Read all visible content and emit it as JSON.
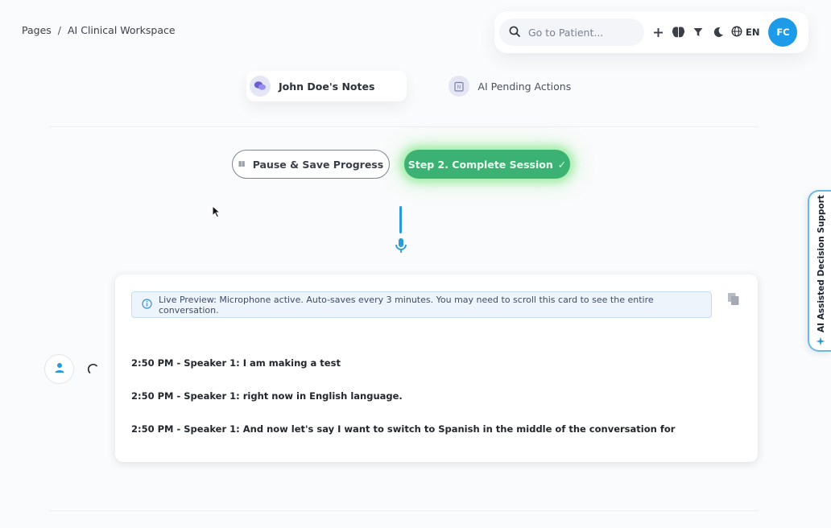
{
  "breadcrumb": {
    "root": "Pages",
    "separator": "/",
    "current": "AI Clinical Workspace"
  },
  "header": {
    "search_placeholder": "Go to Patient...",
    "icons": [
      "search-icon",
      "plus-icon",
      "brain-icon",
      "filter-icon",
      "moon-icon",
      "globe-icon"
    ],
    "language": "EN",
    "avatar_initials": "FC",
    "avatar_color": "#1e9be8"
  },
  "tabs": [
    {
      "label": "John Doe's Notes",
      "icon": "chat-bubbles-icon",
      "active": true
    },
    {
      "label": "AI Pending Actions",
      "icon": "clipboard-icon",
      "active": false
    }
  ],
  "actions": {
    "pause_label": "Pause & Save Progress",
    "complete_label": "Step 2. Complete Session",
    "complete_check": "✓",
    "complete_color": "#3bb274"
  },
  "transcript": {
    "info_text": "Live Preview: Microphone active. Auto-saves every 3 minutes. You may need to scroll this card to see the entire conversation.",
    "lines": [
      "2:50 PM - Speaker 1: I am making a test",
      "2:50 PM - Speaker 1: right now in English language.",
      "2:50 PM - Speaker 1: And now let's say I want to switch to Spanish in the middle of the conversation for"
    ]
  },
  "side_panel": {
    "label": "AI Assisted Decision Support",
    "accent": "#6ab8e8"
  }
}
